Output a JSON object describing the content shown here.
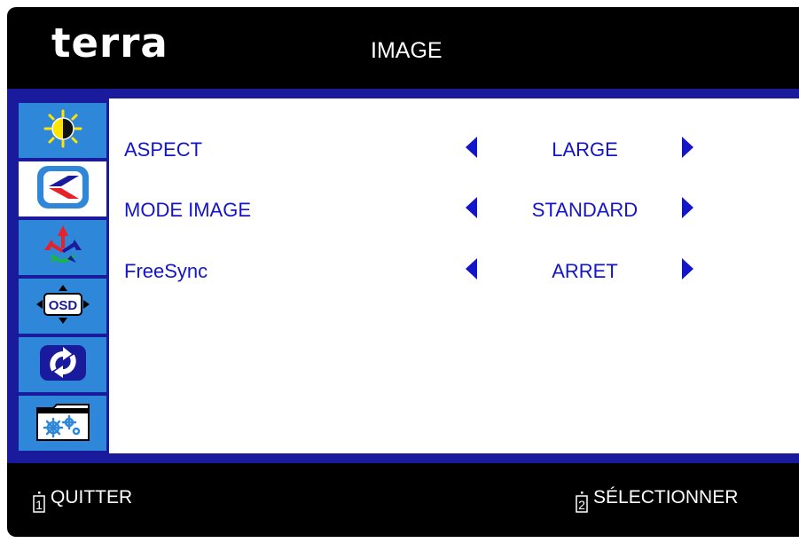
{
  "header": {
    "logo": "terra",
    "title": "IMAGE"
  },
  "sidebar": {
    "items": [
      {
        "icon": "brightness-contrast-icon",
        "active": false
      },
      {
        "icon": "image-icon",
        "active": true
      },
      {
        "icon": "color-icon",
        "active": false
      },
      {
        "icon": "osd-position-icon",
        "active": false
      },
      {
        "icon": "reset-icon",
        "active": false
      },
      {
        "icon": "settings-icon",
        "active": false
      }
    ]
  },
  "main": {
    "rows": [
      {
        "label": "ASPECT",
        "value": "LARGE"
      },
      {
        "label": "MODE IMAGE",
        "value": "STANDARD"
      },
      {
        "label": "FreeSync",
        "value": "ARRET"
      }
    ]
  },
  "footer": {
    "left": {
      "key": "1",
      "label": "QUITTER"
    },
    "right": {
      "key": "2",
      "label": "SÉLECTIONNER"
    }
  },
  "colors": {
    "accent_blue": "#1a1a9c",
    "text_blue": "#1414c8",
    "sidebar_tile": "#2f87d9",
    "background": "#000000"
  }
}
